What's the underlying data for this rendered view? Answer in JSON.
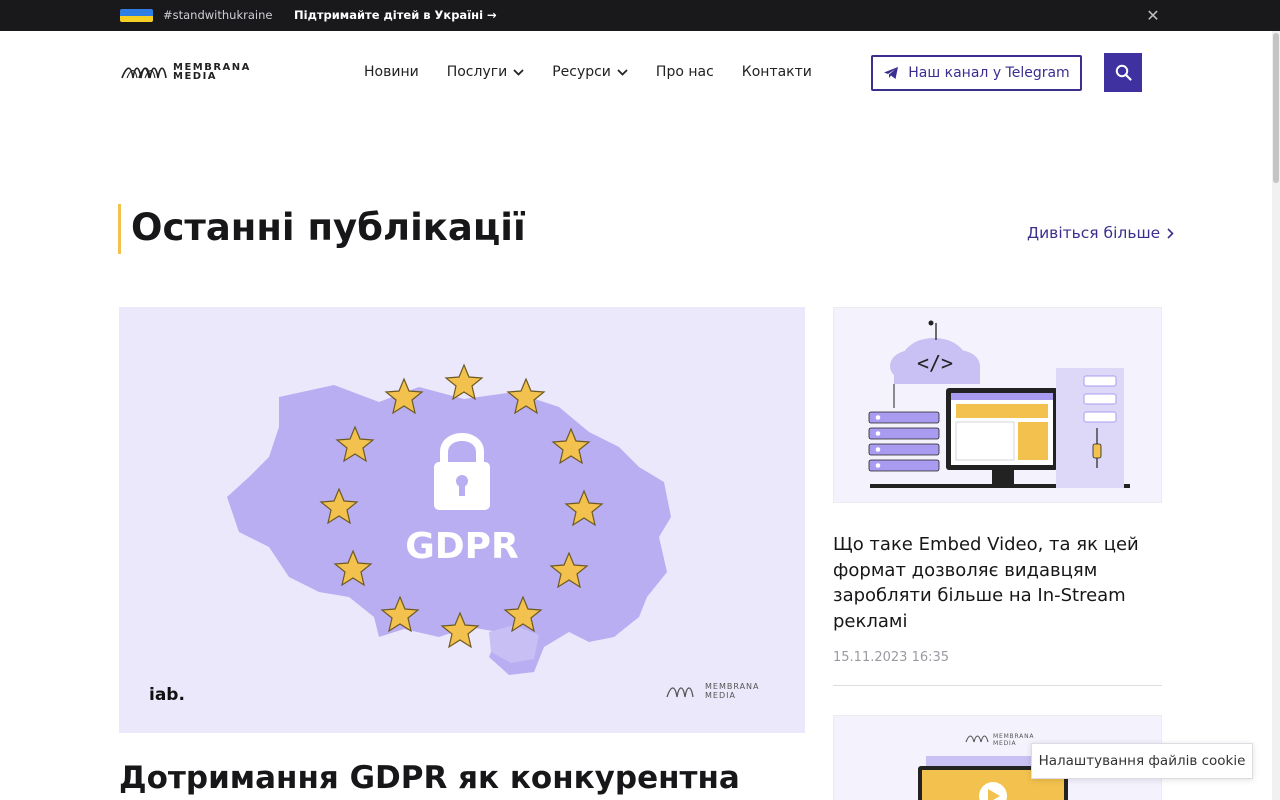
{
  "banner": {
    "hashtag": "#standwithukraine",
    "link_text": "Підтримайте дітей в Україні →",
    "close_icon": "close-icon",
    "flag_colors": [
      "#2f7ee3",
      "#f5d023"
    ]
  },
  "header": {
    "logo_line1": "MEMBRANA",
    "logo_line2": "MEDIA",
    "nav": [
      {
        "label": "Новини",
        "has_dropdown": false
      },
      {
        "label": "Послуги",
        "has_dropdown": true
      },
      {
        "label": "Ресурси",
        "has_dropdown": true
      },
      {
        "label": "Про нас",
        "has_dropdown": false
      },
      {
        "label": "Контакти",
        "has_dropdown": false
      }
    ],
    "telegram_label": "Наш канал у Telegram",
    "telegram_icon": "telegram-icon",
    "search_icon": "search-icon",
    "accent_color": "#3f32a0"
  },
  "section": {
    "title": "Останні публікації",
    "see_more": "Дивіться більше",
    "accent_color": "#f2c14e"
  },
  "feature": {
    "image_text": "GDPR",
    "image_logo_left": "iab.",
    "image_logo_right_1": "MEMBRANA",
    "image_logo_right_2": "MEDIA",
    "title": "Дотримання GDPR як конкурентна"
  },
  "side_articles": [
    {
      "title": "Що таке Embed Video, та як цей формат дозволяє видавцям заробляти більше на In-Stream рекламі",
      "date": "15.11.2023 16:35",
      "image_code_label": "</>"
    },
    {
      "image_logo_1": "MEMBRANA",
      "image_logo_2": "MEDIA"
    }
  ],
  "cookie": {
    "label": "Налаштування файлів cookie"
  }
}
